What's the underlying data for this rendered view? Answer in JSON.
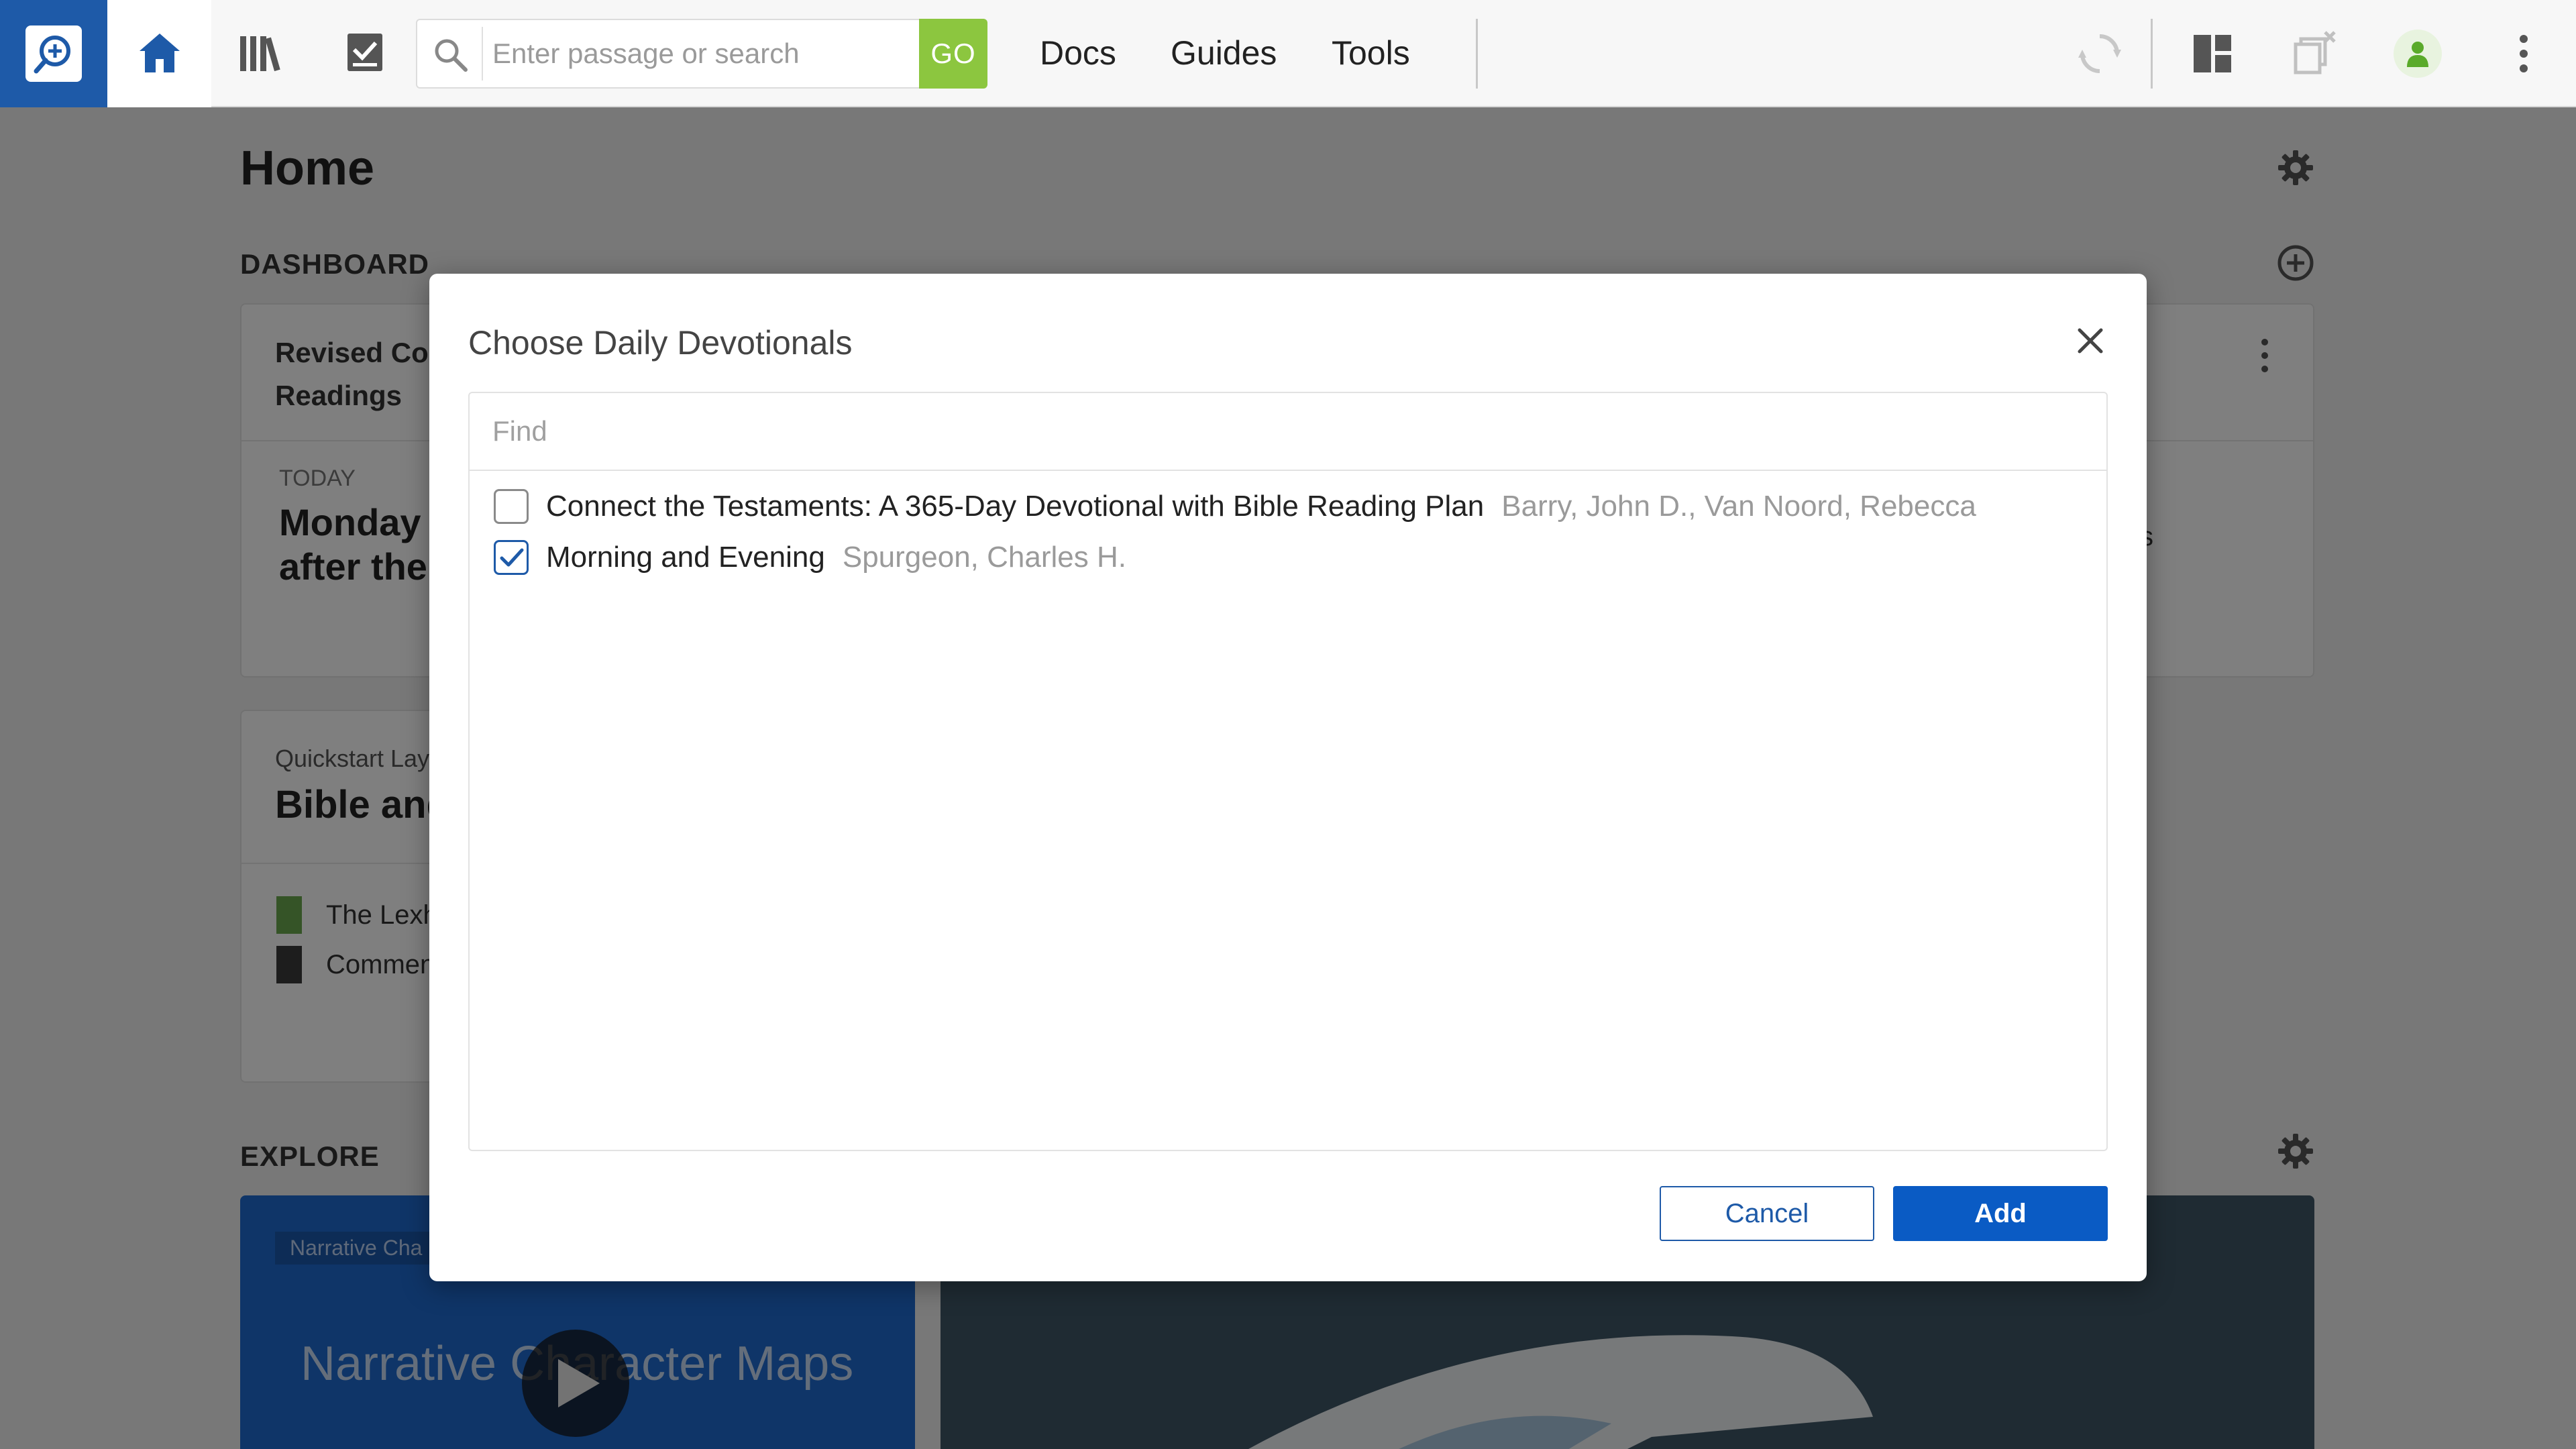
{
  "toolbar": {
    "search_placeholder": "Enter passage or search",
    "go_label": "GO",
    "nav": [
      "Docs",
      "Guides",
      "Tools"
    ]
  },
  "page": {
    "title": "Home",
    "dashboard_label": "DASHBOARD",
    "explore_label": "EXPLORE",
    "card1": {
      "title_line1": "Revised Con",
      "title_line2": "Readings",
      "today_label": "TODAY",
      "reading_line1": "Monday a",
      "reading_line2": "after the",
      "right_fragment": "s"
    },
    "card2": {
      "kicker": "Quickstart Layo",
      "title": "Bible and",
      "item1": "The Lexh",
      "item2": "Commen"
    },
    "explore": {
      "tag": "Narrative Cha",
      "banner_text": "Narrative Character Maps"
    }
  },
  "modal": {
    "title": "Choose Daily Devotionals",
    "find_placeholder": "Find",
    "items": [
      {
        "title": "Connect the Testaments: A 365-Day Devotional with Bible Reading Plan",
        "author": "Barry, John D., Van Noord, Rebecca",
        "checked": false
      },
      {
        "title": "Morning and Evening",
        "author": "Spurgeon, Charles H.",
        "checked": true
      }
    ],
    "cancel_label": "Cancel",
    "add_label": "Add"
  },
  "colors": {
    "brand_blue": "#1e5aa8",
    "go_green": "#8cc63f",
    "add_blue": "#0a5bc4"
  }
}
